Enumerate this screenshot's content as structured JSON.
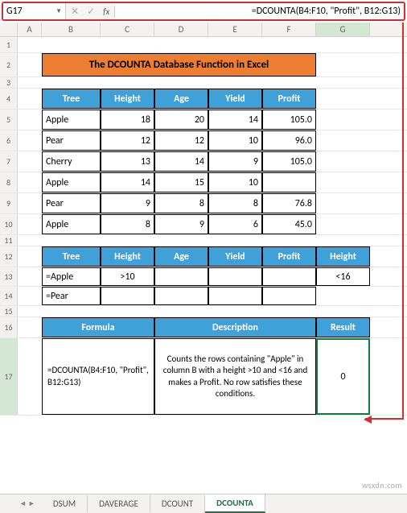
{
  "name_box": "G17",
  "formula": "=DCOUNTA(B4:F10, \"Profit\", B12:G13)",
  "columns": [
    "A",
    "B",
    "C",
    "D",
    "E",
    "F",
    "G"
  ],
  "title": "The DCOUNTA Database Function in Excel",
  "table1": {
    "headers": [
      "Tree",
      "Height",
      "Age",
      "Yield",
      "Profit"
    ],
    "rows": [
      [
        "Apple",
        "18",
        "20",
        "14",
        "105.0"
      ],
      [
        "Pear",
        "12",
        "12",
        "10",
        "96.0"
      ],
      [
        "Cherry",
        "13",
        "14",
        "9",
        "105.0"
      ],
      [
        "Apple",
        "14",
        "15",
        "10",
        ""
      ],
      [
        "Pear",
        "9",
        "8",
        "8",
        "76.8"
      ],
      [
        "Apple",
        "8",
        "9",
        "6",
        "45.0"
      ]
    ]
  },
  "table2": {
    "headers": [
      "Tree",
      "Height",
      "Age",
      "Yield",
      "Profit",
      "Height"
    ],
    "rows": [
      [
        "=Apple",
        ">10",
        "",
        "",
        "",
        "<16"
      ],
      [
        "=Pear",
        "",
        "",
        "",
        "",
        ""
      ]
    ]
  },
  "table3": {
    "headers": [
      "Formula",
      "Description",
      "Result"
    ],
    "formula_cell": "=DCOUNTA(B4:F10, \"Profit\", B12:G13)",
    "description": "Counts the rows containing \"Apple\" in column B with a height >10 and <16 and makes a Profit. No row satisfies these conditions.",
    "result": "0"
  },
  "sheet_tabs": [
    "DSUM",
    "DAVERAGE",
    "DCOUNT",
    "DCOUNTA"
  ],
  "active_tab": "DCOUNTA",
  "watermark": "wsxdn.com"
}
